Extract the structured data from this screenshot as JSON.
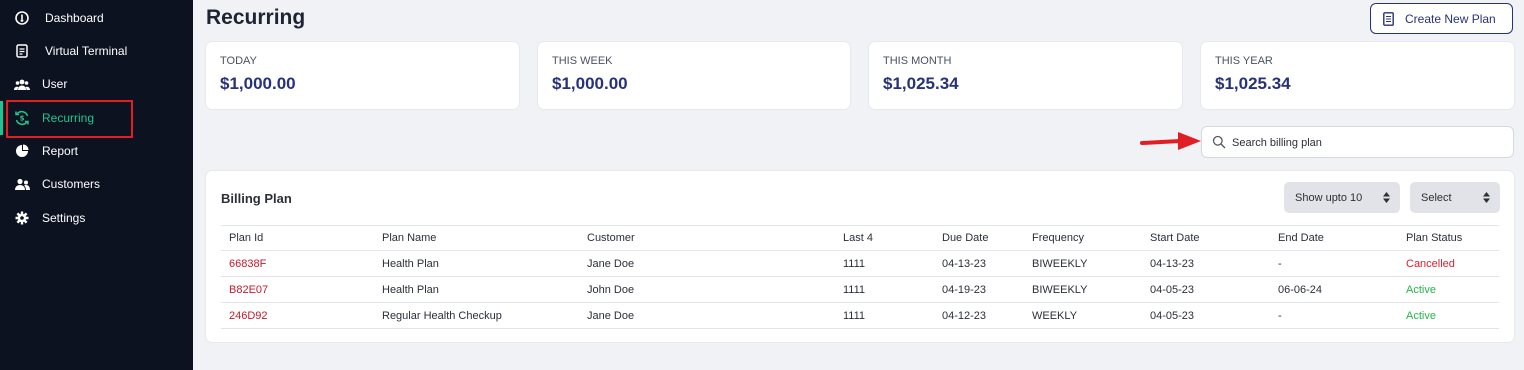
{
  "sidebar": {
    "items": [
      {
        "label": "Dashboard",
        "icon": "dashboard-icon"
      },
      {
        "label": "Virtual Terminal",
        "icon": "terminal-icon"
      },
      {
        "label": "User",
        "icon": "users-icon"
      },
      {
        "label": "Recurring",
        "icon": "recurring-icon"
      },
      {
        "label": "Report",
        "icon": "pie-chart-icon"
      },
      {
        "label": "Customers",
        "icon": "customers-icon"
      },
      {
        "label": "Settings",
        "icon": "gear-icon"
      }
    ],
    "active_color": "#20c48f"
  },
  "header": {
    "title": "Recurring",
    "create_label": "Create New Plan"
  },
  "stats": [
    {
      "label": "TODAY",
      "value": "$1,000.00"
    },
    {
      "label": "THIS WEEK",
      "value": "$1,000.00"
    },
    {
      "label": "THIS MONTH",
      "value": "$1,025.34"
    },
    {
      "label": "THIS YEAR",
      "value": "$1,025.34"
    }
  ],
  "search": {
    "placeholder": "Search billing plan"
  },
  "panel": {
    "title": "Billing Plan",
    "page_size_label": "Show upto 10",
    "filter_label": "Select"
  },
  "table": {
    "columns": [
      "Plan Id",
      "Plan Name",
      "Customer",
      "Last 4",
      "Due Date",
      "Frequency",
      "Start Date",
      "End Date",
      "Plan Status"
    ],
    "rows": [
      {
        "id": "66838F",
        "name": "Health Plan",
        "customer": "Jane Doe",
        "last4": "1111",
        "due": "04-13-23",
        "freq": "BIWEEKLY",
        "start": "04-13-23",
        "end": "-",
        "status": "Cancelled"
      },
      {
        "id": "B82E07",
        "name": "Health Plan",
        "customer": "John Doe",
        "last4": "1111",
        "due": "04-19-23",
        "freq": "BIWEEKLY",
        "start": "04-05-23",
        "end": "06-06-24",
        "status": "Active"
      },
      {
        "id": "246D92",
        "name": "Regular Health Checkup",
        "customer": "Jane Doe",
        "last4": "1111",
        "due": "04-12-23",
        "freq": "WEEKLY",
        "start": "04-05-23",
        "end": "-",
        "status": "Active"
      }
    ]
  },
  "colors": {
    "brand": "#27327a",
    "cancelled": "#d61f2c",
    "active": "#26b54a",
    "plan_id": "#c41a2c",
    "annotation": "#e01e24"
  }
}
